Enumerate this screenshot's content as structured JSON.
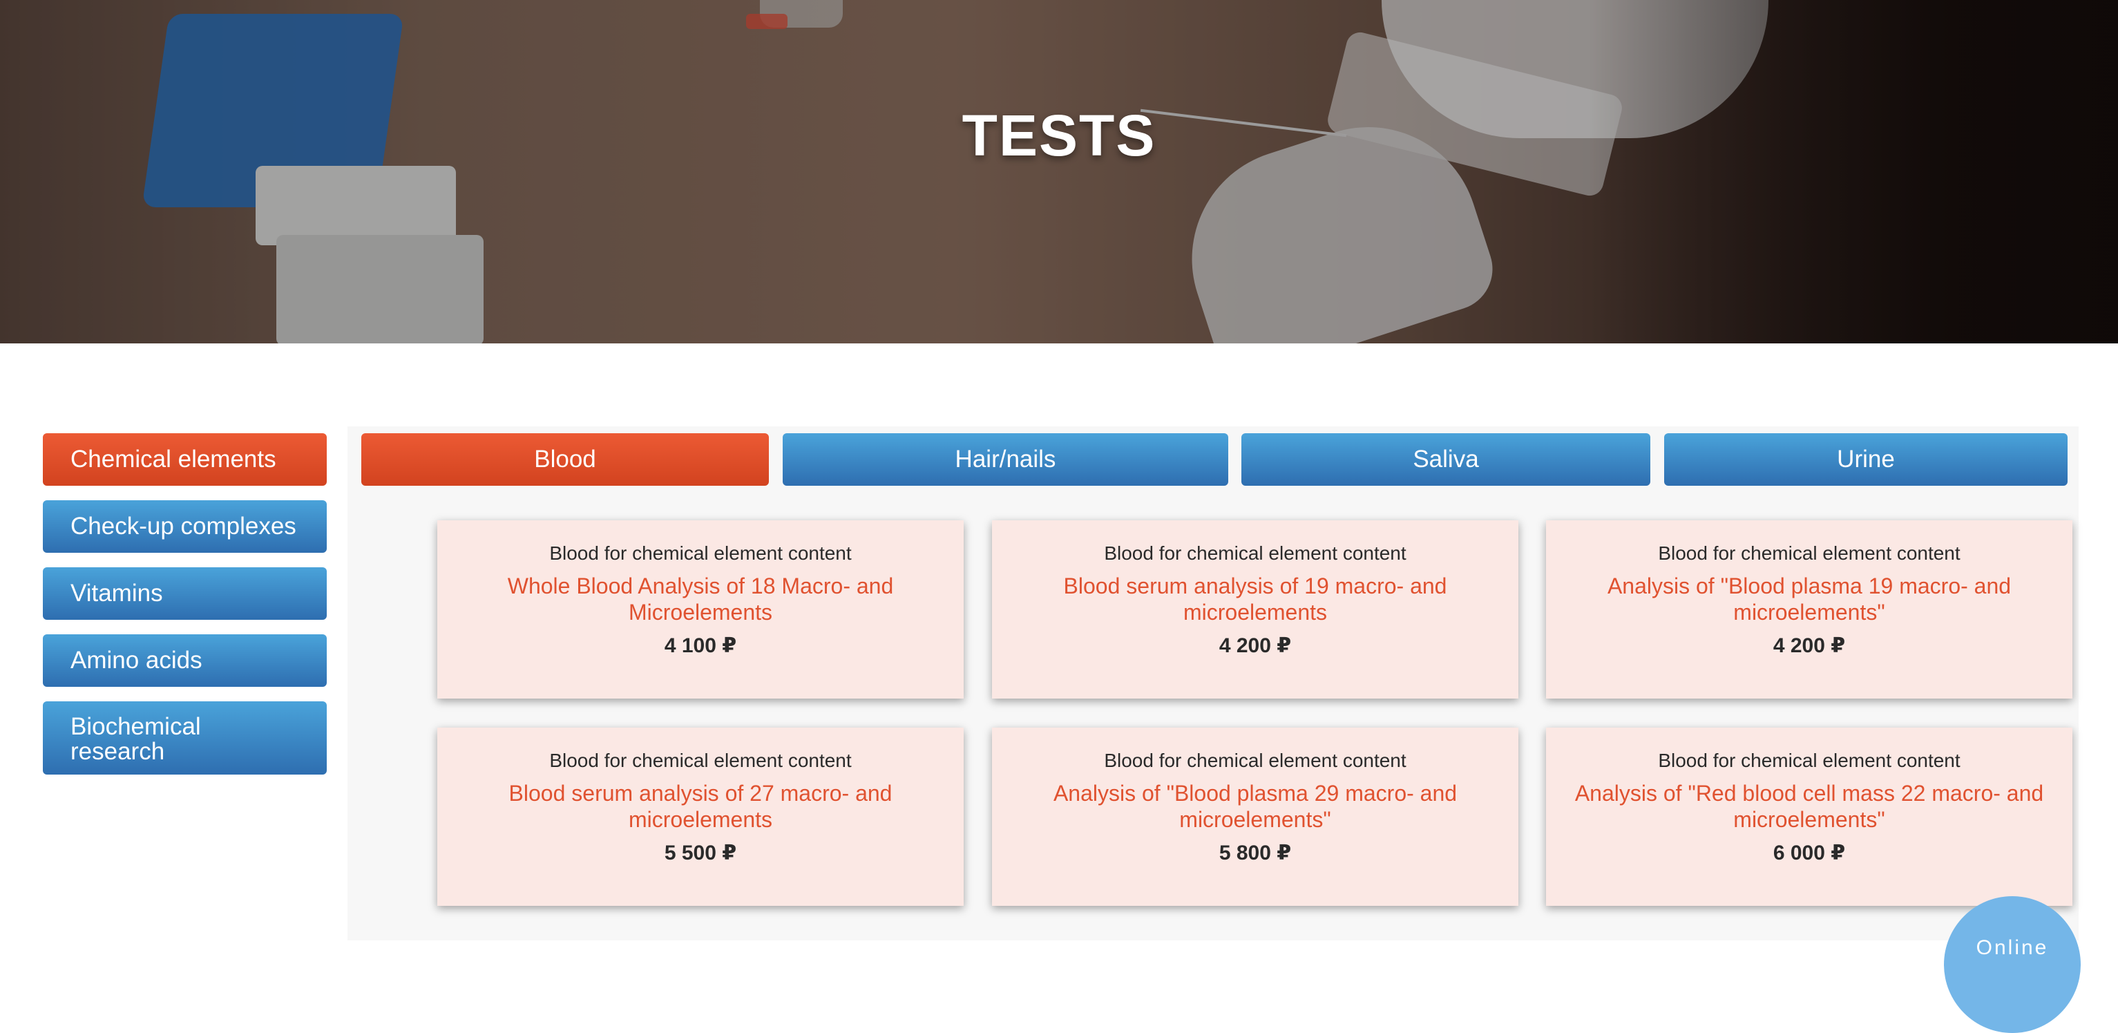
{
  "hero": {
    "title": "TESTS"
  },
  "sidebar": {
    "items": [
      {
        "label": "Chemical elements",
        "active": true
      },
      {
        "label": "Check-up complexes",
        "active": false
      },
      {
        "label": "Vitamins",
        "active": false
      },
      {
        "label": "Amino acids",
        "active": false
      },
      {
        "label": "Biochemical research",
        "active": false
      }
    ]
  },
  "tabs": [
    {
      "label": "Blood",
      "active": true
    },
    {
      "label": "Hair/nails",
      "active": false
    },
    {
      "label": "Saliva",
      "active": false
    },
    {
      "label": "Urine",
      "active": false
    }
  ],
  "cards": [
    {
      "category": "Blood for chemical element content",
      "name": "Whole Blood Analysis of 18 Macro- and Microelements",
      "price": "4 100 ₽"
    },
    {
      "category": "Blood for chemical element content",
      "name": "Blood serum analysis of 19 macro- and microelements",
      "price": "4 200 ₽"
    },
    {
      "category": "Blood for chemical element content",
      "name": "Analysis of \"Blood plasma 19 macro- and microelements\"",
      "price": "4 200 ₽"
    },
    {
      "category": "Blood for chemical element content",
      "name": "Blood serum analysis of 27 macro- and microelements",
      "price": "5 500 ₽"
    },
    {
      "category": "Blood for chemical element content",
      "name": "Analysis of \"Blood plasma 29 macro- and microelements\"",
      "price": "5 800 ₽"
    },
    {
      "category": "Blood for chemical element content",
      "name": "Analysis of \"Red blood cell mass 22 macro- and microelements\"",
      "price": "6 000 ₽"
    }
  ],
  "chat": {
    "label": "Online"
  },
  "colors": {
    "accent": "#e05230",
    "primary": "#2e6eb0",
    "card_bg": "#fbe8e4"
  }
}
